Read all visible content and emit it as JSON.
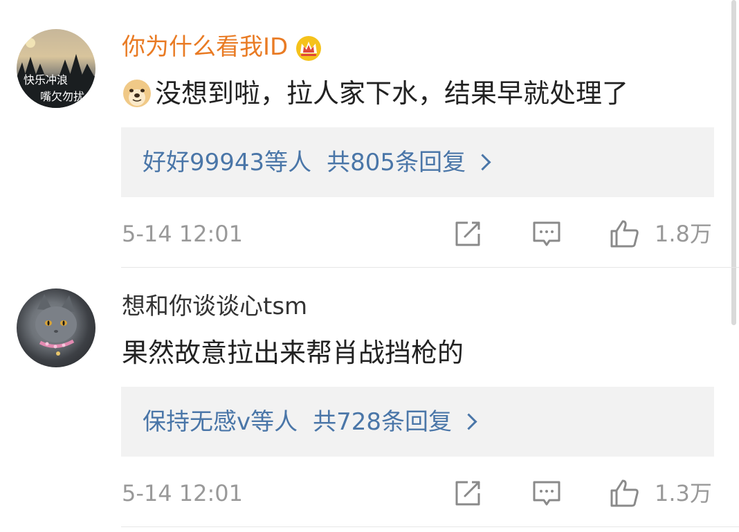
{
  "comments": [
    {
      "avatar_text_line1": "快乐冲浪",
      "avatar_text_line2": "嘴欠勿扰",
      "username": "你为什么看我ID",
      "badge_icon": "crown-icon",
      "text": "没想到啦，拉人家下水，结果早就处理了",
      "emoji_icon": "doge-emoji-icon",
      "reply_users": "好好99943等人",
      "reply_count": "共805条回复",
      "time": "5-14 12:01",
      "like_count": "1.8万"
    },
    {
      "username": "想和你谈谈心tsm",
      "text": "果然故意拉出来帮肖战挡枪的",
      "reply_users": "保持无感v等人",
      "reply_count": "共728条回复",
      "time": "5-14 12:01",
      "like_count": "1.3万"
    }
  ],
  "colors": {
    "vip_username": "#e97b24",
    "username": "#333333",
    "link": "#4a76a8",
    "meta": "#999999",
    "reply_bg": "#f2f2f2"
  }
}
